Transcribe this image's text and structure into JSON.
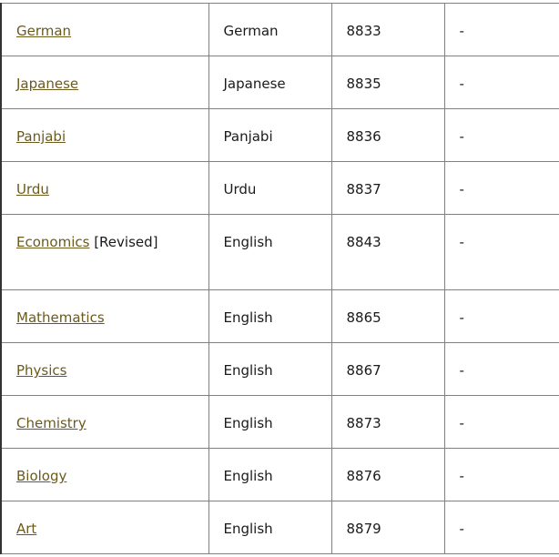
{
  "rows": [
    {
      "subject": "German",
      "suffix": "",
      "language": "German",
      "code": "8833",
      "note": "-"
    },
    {
      "subject": "Japanese",
      "suffix": "",
      "language": "Japanese",
      "code": "8835",
      "note": "-"
    },
    {
      "subject": "Panjabi",
      "suffix": "",
      "language": "Panjabi",
      "code": "8836",
      "note": "-"
    },
    {
      "subject": "Urdu",
      "suffix": "",
      "language": "Urdu",
      "code": "8837",
      "note": "-"
    },
    {
      "subject": "Economics",
      "suffix": " [Revised]",
      "language": "English",
      "code": "8843",
      "note": "-"
    },
    {
      "subject": "Mathematics",
      "suffix": "",
      "language": "English",
      "code": "8865",
      "note": "-"
    },
    {
      "subject": "Physics",
      "suffix": "",
      "language": "English",
      "code": "8867",
      "note": "-"
    },
    {
      "subject": "Chemistry",
      "suffix": "",
      "language": "English",
      "code": "8873",
      "note": "-"
    },
    {
      "subject": "Biology",
      "suffix": "",
      "language": "English",
      "code": "8876",
      "note": "-"
    },
    {
      "subject": "Art",
      "suffix": "",
      "language": "English",
      "code": "8879",
      "note": "-"
    }
  ],
  "colors": {
    "link": "#6b5a1e",
    "border": "#808080"
  }
}
